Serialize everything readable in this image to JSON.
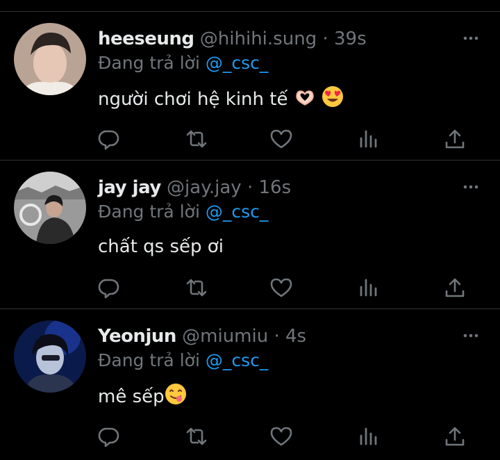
{
  "tweets": [
    {
      "name": "heeseung",
      "handle": "@hihihi.sung",
      "separator": "·",
      "time": "39s",
      "reply_prefix": "Đang trả lời",
      "reply_to": "@_csc_",
      "text": "người chơi hệ kinh tế",
      "emojis": [
        "heart-hands-emoji",
        "heart-eyes-emoji"
      ]
    },
    {
      "name": "jay jay",
      "handle": "@jay.jay",
      "separator": "·",
      "time": "16s",
      "reply_prefix": "Đang trả lời",
      "reply_to": "@_csc_",
      "text": "chất qs sếp ơi",
      "emojis": []
    },
    {
      "name": "Yeonjun",
      "handle": "@miumiu",
      "separator": "·",
      "time": "4s",
      "reply_prefix": "Đang trả lời",
      "reply_to": "@_csc_",
      "text": "mê sếp",
      "emojis": [
        "yum-emoji"
      ]
    }
  ],
  "colors": {
    "background": "#000000",
    "text": "#e7e9ea",
    "muted": "#71767b",
    "accent": "#1d9bf0",
    "divider": "#2f3336"
  },
  "icons": [
    "reply-icon",
    "retweet-icon",
    "like-icon",
    "views-icon",
    "share-icon",
    "more-icon"
  ]
}
